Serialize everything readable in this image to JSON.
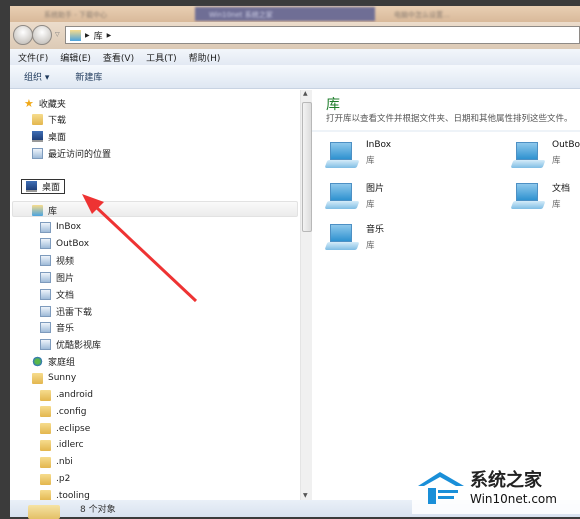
{
  "tabs": [
    "系统助手 - 下载中心",
    "Win10net 系统之家",
    "电脑中怎么设置..."
  ],
  "address": {
    "path": [
      "库"
    ]
  },
  "menu": [
    "文件(F)",
    "编辑(E)",
    "查看(V)",
    "工具(T)",
    "帮助(H)"
  ],
  "toolbar": {
    "organize": "组织 ▾",
    "new_library": "新建库"
  },
  "nav": {
    "favorites": {
      "label": "收藏夹",
      "items": [
        "下载",
        "桌面",
        "最近访问的位置"
      ]
    },
    "desktop": "桌面",
    "library": {
      "label": "库",
      "items": [
        "InBox",
        "OutBox",
        "视频",
        "图片",
        "文档",
        "迅雷下载",
        "音乐",
        "优酷影视库"
      ]
    },
    "homegroup": "家庭组",
    "user": {
      "label": "Sunny",
      "items": [
        ".android",
        ".config",
        ".eclipse",
        ".idlerc",
        ".nbi",
        ".p2",
        ".tooling"
      ]
    }
  },
  "content": {
    "title": "库",
    "description": "打开库以查看文件并根据文件夹、日期和其他属性排列这些文件。",
    "items": [
      {
        "name": "InBox",
        "type": "库",
        "icon": "library-icon"
      },
      {
        "name": "OutBox",
        "type": "库",
        "icon": "library-icon"
      },
      {
        "name": "图片",
        "type": "库",
        "icon": "pictures-icon"
      },
      {
        "name": "文档",
        "type": "库",
        "icon": "documents-icon"
      },
      {
        "name": "音乐",
        "type": "库",
        "icon": "music-icon"
      }
    ]
  },
  "status": {
    "count": "8 个对象"
  },
  "watermark": {
    "name": "系统之家",
    "site": "Win10net.com"
  },
  "colors": {
    "accent_title": "#1e7d2b",
    "annotation_arrow": "#ee3333"
  }
}
